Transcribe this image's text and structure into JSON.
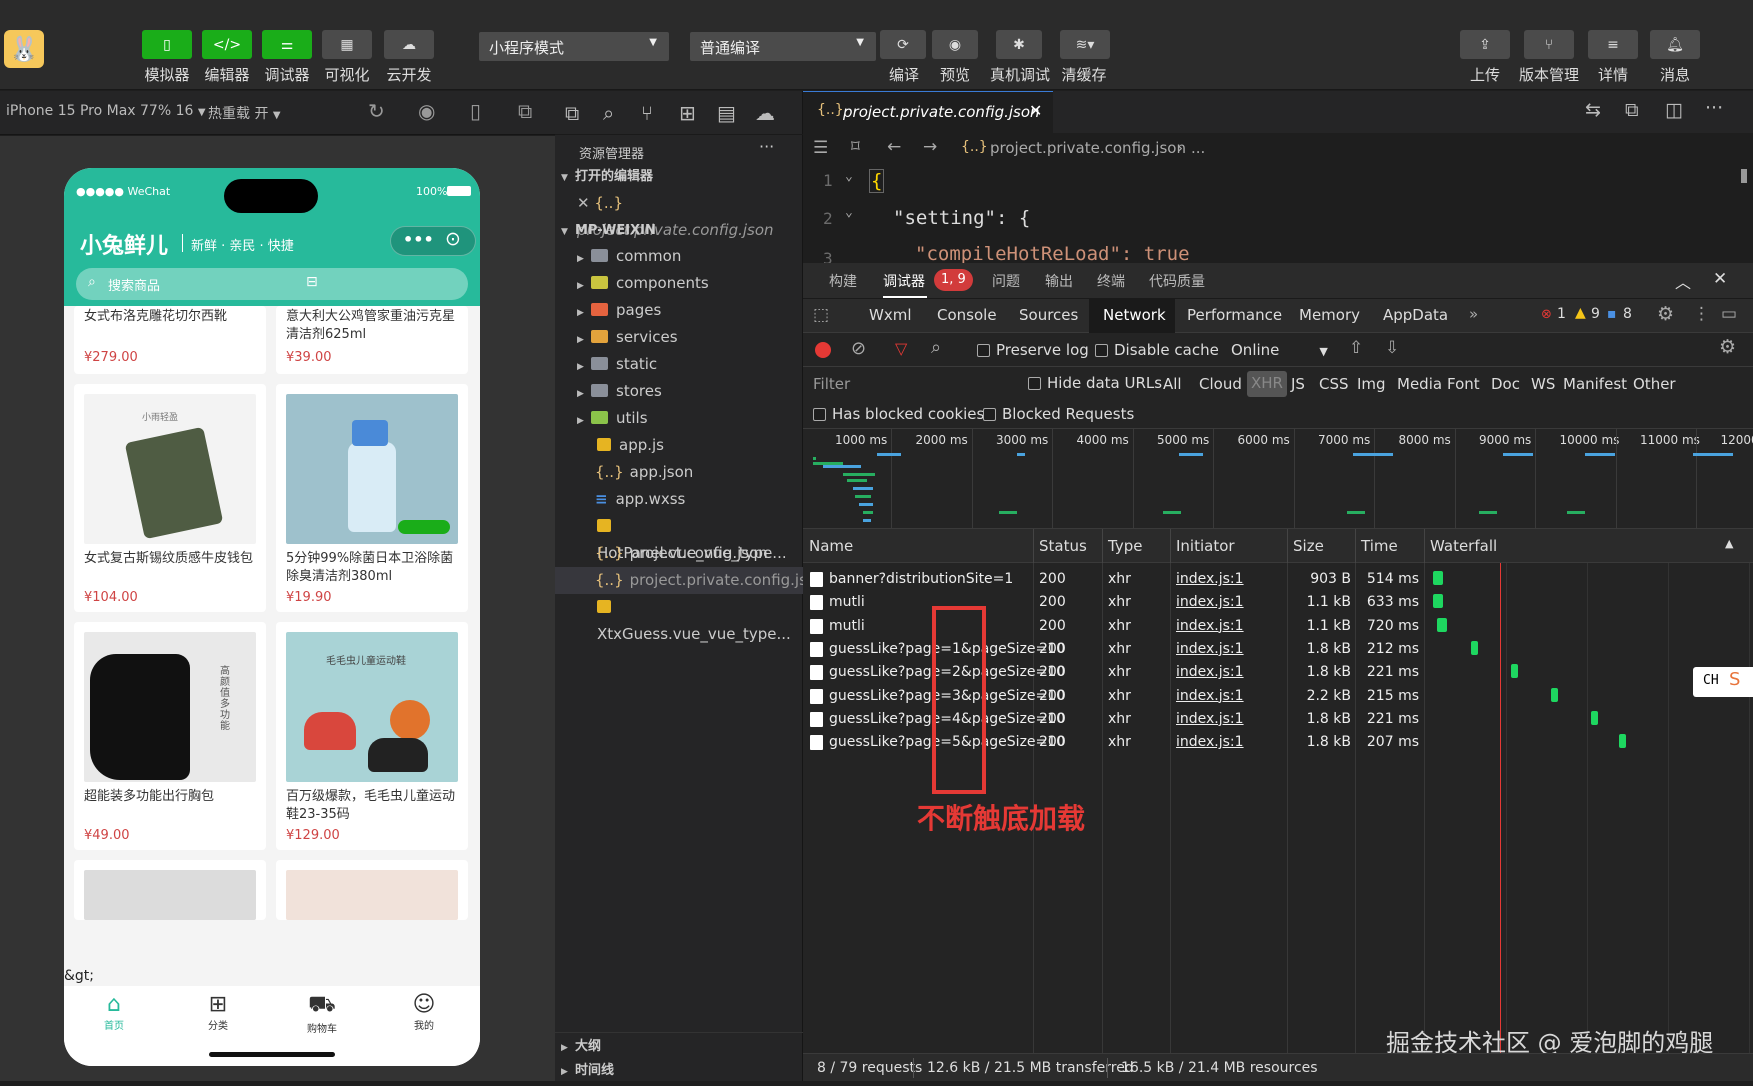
{
  "toolbar": {
    "buttons": [
      {
        "label": "模拟器"
      },
      {
        "label": "编辑器"
      },
      {
        "label": "调试器"
      },
      {
        "label": "可视化"
      },
      {
        "label": "云开发"
      }
    ],
    "mode_select": "小程序模式",
    "compile_select": "普通编译",
    "actions": [
      {
        "label": "编译"
      },
      {
        "label": "预览"
      },
      {
        "label": "真机调试"
      },
      {
        "label": "清缓存"
      }
    ],
    "right_actions": [
      {
        "label": "上传"
      },
      {
        "label": "版本管理"
      },
      {
        "label": "详情"
      },
      {
        "label": "消息"
      }
    ]
  },
  "simulator": {
    "device": "iPhone 15 Pro Max 77% 16",
    "hot_reload": "热重载 开",
    "status_left": "●●●●● WeChat",
    "status_right": "100%",
    "app_title": "小兔鲜儿",
    "app_subtitle": "新鲜 · 亲民 · 快捷",
    "search_placeholder": "搜索商品",
    "stray_text": "&gt;",
    "products": [
      {
        "name": "女式布洛克雕花切尔西靴",
        "price": "¥279.00"
      },
      {
        "name": "意大利大公鸡管家重油污克星清洁剂625ml",
        "price": "¥39.00"
      },
      {
        "name": "女式复古斯锡纹质感牛皮钱包",
        "price": "¥104.00",
        "img_text": "小雨轻盈"
      },
      {
        "name": "5分钟99%除菌日本卫浴除菌除臭清洁剂380ml",
        "price": "¥19.90"
      },
      {
        "name": "超能装多功能出行胸包",
        "price": "¥49.00",
        "img_text": "高颜值多功能"
      },
      {
        "name": "百万级爆款，毛毛虫儿童运动鞋23-35码",
        "price": "¥129.00",
        "img_text": "毛毛虫儿童运动鞋"
      }
    ],
    "tabbar": [
      {
        "label": "首页"
      },
      {
        "label": "分类"
      },
      {
        "label": "购物车"
      },
      {
        "label": "我的"
      }
    ]
  },
  "explorer": {
    "title": "资源管理器",
    "open_editors": "打开的编辑器",
    "open_file": "project.private.config.json",
    "project": "MP-WEIXIN",
    "items": [
      {
        "name": "common",
        "kind": "folder"
      },
      {
        "name": "components",
        "kind": "folder"
      },
      {
        "name": "pages",
        "kind": "folder"
      },
      {
        "name": "services",
        "kind": "folder"
      },
      {
        "name": "static",
        "kind": "folder"
      },
      {
        "name": "stores",
        "kind": "folder"
      },
      {
        "name": "utils",
        "kind": "folder"
      },
      {
        "name": "app.js",
        "kind": "file"
      },
      {
        "name": "app.json",
        "kind": "file"
      },
      {
        "name": "app.wxss",
        "kind": "file"
      },
      {
        "name": "HotPanel.vue_vue_type...",
        "kind": "file"
      },
      {
        "name": "project.config.json",
        "kind": "file"
      },
      {
        "name": "project.private.config.js...",
        "kind": "file"
      },
      {
        "name": "XtxGuess.vue_vue_type...",
        "kind": "file"
      }
    ],
    "outline": "大纲",
    "timeline": "时间线"
  },
  "editor": {
    "tab": "project.private.config.json",
    "breadcrumb": "project.private.config.json",
    "breadcrumb_more": "...",
    "lines": [
      {
        "num": "1",
        "text": "{"
      },
      {
        "num": "2",
        "text": "\"setting\": {"
      },
      {
        "num": "3",
        "text": "\"compileHotReLoad\": true"
      }
    ]
  },
  "devtools": {
    "top_tabs": [
      {
        "label": "构建"
      },
      {
        "label": "调试器"
      },
      {
        "label": "问题"
      },
      {
        "label": "输出"
      },
      {
        "label": "终端"
      },
      {
        "label": "代码质量"
      }
    ],
    "debugger_badge": "1, 9",
    "panel_tabs": [
      {
        "label": "Wxml"
      },
      {
        "label": "Console"
      },
      {
        "label": "Sources"
      },
      {
        "label": "Network"
      },
      {
        "label": "Performance"
      },
      {
        "label": "Memory"
      },
      {
        "label": "AppData"
      }
    ],
    "more_tabs": "»",
    "errors": "1",
    "warnings": "9",
    "infos": "8",
    "preserve_log": "Preserve log",
    "disable_cache": "Disable cache",
    "throttling": "Online",
    "filter_placeholder": "Filter",
    "hide_data_urls": "Hide data URLs",
    "type_filters": [
      "All",
      "Cloud",
      "XHR",
      "JS",
      "CSS",
      "Img",
      "Media",
      "Font",
      "Doc",
      "WS",
      "Manifest",
      "Other"
    ],
    "has_blocked_cookies": "Has blocked cookies",
    "blocked_requests": "Blocked Requests",
    "timeline_ticks": [
      "1000 ms",
      "2000 ms",
      "3000 ms",
      "4000 ms",
      "5000 ms",
      "6000 ms",
      "7000 ms",
      "8000 ms",
      "9000 ms",
      "10000 ms",
      "11000 ms",
      "12000"
    ],
    "columns": [
      "Name",
      "Status",
      "Type",
      "Initiator",
      "Size",
      "Time",
      "Waterfall"
    ],
    "requests": [
      {
        "name": "banner?distributionSite=1",
        "status": "200",
        "type": "xhr",
        "initiator": "index.js:1",
        "size": "903 B",
        "time": "514 ms"
      },
      {
        "name": "mutli",
        "status": "200",
        "type": "xhr",
        "initiator": "index.js:1",
        "size": "1.1 kB",
        "time": "633 ms"
      },
      {
        "name": "mutli",
        "status": "200",
        "type": "xhr",
        "initiator": "index.js:1",
        "size": "1.1 kB",
        "time": "720 ms"
      },
      {
        "name": "guessLike?page=1&pageSize=10",
        "status": "200",
        "type": "xhr",
        "initiator": "index.js:1",
        "size": "1.8 kB",
        "time": "212 ms"
      },
      {
        "name": "guessLike?page=2&pageSize=10",
        "status": "200",
        "type": "xhr",
        "initiator": "index.js:1",
        "size": "1.8 kB",
        "time": "221 ms"
      },
      {
        "name": "guessLike?page=3&pageSize=10",
        "status": "200",
        "type": "xhr",
        "initiator": "index.js:1",
        "size": "2.2 kB",
        "time": "215 ms"
      },
      {
        "name": "guessLike?page=4&pageSize=10",
        "status": "200",
        "type": "xhr",
        "initiator": "index.js:1",
        "size": "1.8 kB",
        "time": "221 ms"
      },
      {
        "name": "guessLike?page=5&pageSize=10",
        "status": "200",
        "type": "xhr",
        "initiator": "index.js:1",
        "size": "1.8 kB",
        "time": "207 ms"
      }
    ],
    "annotation": "不断触底加载",
    "summary_requests": "8 / 79 requests",
    "summary_transferred": "12.6 kB / 21.5 MB transferred",
    "summary_resources": "16.5 kB / 21.4 MB resources",
    "watermark": "掘金技术社区 @ 爱泡脚的鸡腿",
    "ime": "CH"
  },
  "colors": {
    "accent_green": "#1aad19",
    "brand_teal": "#27ba9b",
    "annotation_red": "#e53935",
    "price_red": "#cf4444"
  }
}
